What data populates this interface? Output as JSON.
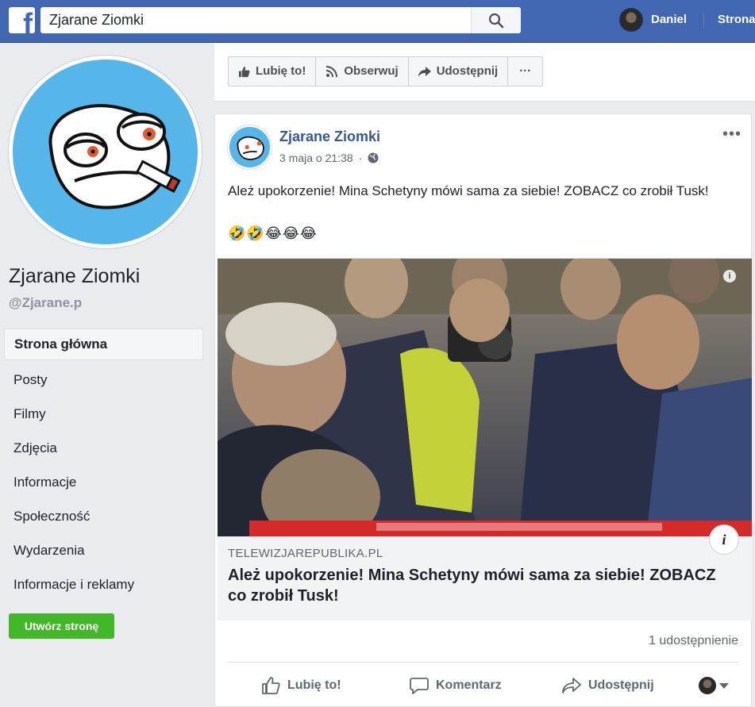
{
  "topbar": {
    "logo_letter": "f",
    "search_value": "Zjarane Ziomki",
    "user_name": "Daniel",
    "home_label": "Strona"
  },
  "page": {
    "name": "Zjarane Ziomki",
    "handle": "@Zjarane.p",
    "nav": [
      {
        "label": "Strona główna",
        "active": true
      },
      {
        "label": "Posty"
      },
      {
        "label": "Filmy"
      },
      {
        "label": "Zdjęcia"
      },
      {
        "label": "Informacje"
      },
      {
        "label": "Społeczność"
      },
      {
        "label": "Wydarzenia"
      },
      {
        "label": "Informacje i reklamy"
      }
    ],
    "create_page_label": "Utwórz stronę"
  },
  "page_actions": {
    "like": "Lubię to!",
    "follow": "Obserwuj",
    "share": "Udostępnij",
    "more": "···"
  },
  "post": {
    "author": "Zjarane Ziomki",
    "time": "3 maja o 21:38",
    "text": "Ależ upokorzenie! Mina Schetyny mówi sama za siebie! ZOBACZ co zrobił Tusk!",
    "emoji": "🤣🤣😂😂😂",
    "link": {
      "domain": "TELEWIZJAREPUBLIKA.PL",
      "title": "Ależ upokorzenie! Mina Schetyny mówi sama za siebie! ZOBACZ co zrobił Tusk!"
    },
    "shares": "1 udostępnienie",
    "actions": {
      "like": "Lubię to!",
      "comment": "Komentarz",
      "share": "Udostępnij"
    }
  },
  "colors": {
    "brand_blue": "#4267b2",
    "link_blue": "#365899",
    "create_green": "#42b72a"
  }
}
